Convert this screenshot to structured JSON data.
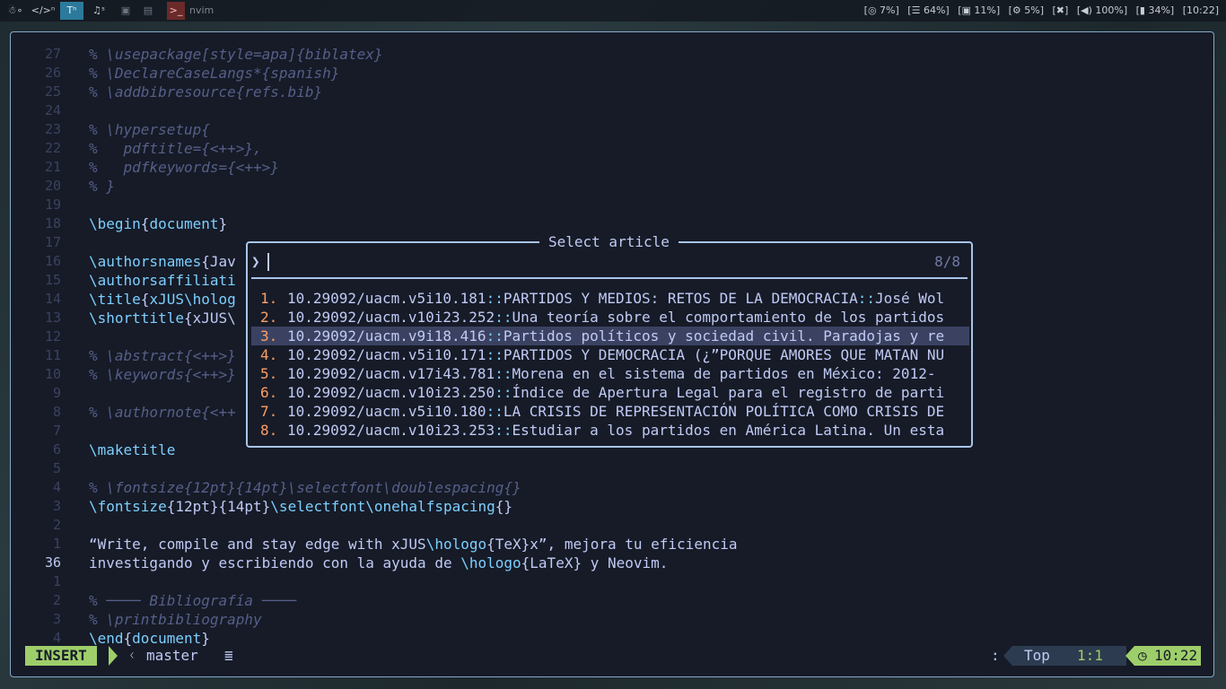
{
  "topbar": {
    "workspaces": [
      "☃∘",
      "</>ⁿ",
      "Tⁿ",
      "♫ˢ",
      "▣",
      "▤",
      ">_"
    ],
    "active_app": "nvim",
    "status": {
      "cpu": "[◎ 7%]",
      "ram": "[☰ 64%]",
      "disk": "[▣ 11%]",
      "temp": "[⚙ 5%]",
      "mic": "[✖]",
      "volume": "[◀) 100%]",
      "battery": "[▮ 34%]",
      "clock": "[10:22]"
    }
  },
  "editor": {
    "lines": [
      {
        "num": "27",
        "segments": [
          [
            "comment",
            "% \\usepackage[style=apa]{biblatex}"
          ]
        ]
      },
      {
        "num": "26",
        "segments": [
          [
            "comment",
            "% \\DeclareCaseLangs*{spanish}"
          ]
        ]
      },
      {
        "num": "25",
        "segments": [
          [
            "comment",
            "% \\addbibresource{refs.bib}"
          ]
        ]
      },
      {
        "num": "24",
        "segments": []
      },
      {
        "num": "23",
        "segments": [
          [
            "comment",
            "% \\hypersetup{"
          ]
        ]
      },
      {
        "num": "22",
        "segments": [
          [
            "comment",
            "%   pdftitle={<++>},"
          ]
        ]
      },
      {
        "num": "21",
        "segments": [
          [
            "comment",
            "%   pdfkeywords={<++>}"
          ]
        ]
      },
      {
        "num": "20",
        "segments": [
          [
            "comment",
            "% }"
          ]
        ]
      },
      {
        "num": "19",
        "segments": []
      },
      {
        "num": "18",
        "segments": [
          [
            "cmd",
            "\\begin"
          ],
          [
            "txt",
            "{"
          ],
          [
            "arg",
            "document"
          ],
          [
            "txt",
            "}"
          ]
        ]
      },
      {
        "num": "17",
        "segments": []
      },
      {
        "num": "16",
        "segments": [
          [
            "cmd",
            "\\authorsnames"
          ],
          [
            "txt",
            "{Jav"
          ]
        ]
      },
      {
        "num": "15",
        "segments": [
          [
            "cmd",
            "\\authorsaffiliati"
          ]
        ]
      },
      {
        "num": "14",
        "segments": [
          [
            "cmd",
            "\\title"
          ],
          [
            "txt",
            "{"
          ],
          [
            "arg",
            "xJUS"
          ],
          [
            "cmd",
            "\\holog"
          ]
        ]
      },
      {
        "num": "13",
        "segments": [
          [
            "cmd",
            "\\shorttitle"
          ],
          [
            "txt",
            "{xJUS\\"
          ]
        ]
      },
      {
        "num": "12",
        "segments": []
      },
      {
        "num": "11",
        "segments": [
          [
            "comment",
            "% \\abstract{<++>}"
          ]
        ]
      },
      {
        "num": "10",
        "segments": [
          [
            "comment",
            "% \\keywords{<++>}"
          ]
        ]
      },
      {
        "num": "9",
        "segments": []
      },
      {
        "num": "8",
        "segments": [
          [
            "comment",
            "% \\authornote{<++"
          ]
        ]
      },
      {
        "num": "7",
        "segments": []
      },
      {
        "num": "6",
        "segments": [
          [
            "cmd",
            "\\maketitle"
          ]
        ]
      },
      {
        "num": "5",
        "segments": []
      },
      {
        "num": "4",
        "segments": [
          [
            "comment",
            "% \\fontsize{12pt}{14pt}\\selectfont\\doublespacing{}"
          ]
        ]
      },
      {
        "num": "3",
        "segments": [
          [
            "cmd",
            "\\fontsize"
          ],
          [
            "txt",
            "{12pt}{14pt}"
          ],
          [
            "cmd",
            "\\selectfont\\onehalfspacing"
          ],
          [
            "txt",
            "{}"
          ]
        ]
      },
      {
        "num": "2",
        "segments": []
      },
      {
        "num": "1",
        "segments": [
          [
            "txt",
            "“Write, compile and stay edge with xJUS"
          ],
          [
            "cmd",
            "\\hologo"
          ],
          [
            "txt",
            "{TeX}x”, mejora tu eficiencia"
          ]
        ]
      },
      {
        "num": "36",
        "current": true,
        "segments": [
          [
            "txt",
            "investigando y escribiendo con la ayuda de "
          ],
          [
            "cmd",
            "\\hologo"
          ],
          [
            "txt",
            "{LaTeX} y Neovim."
          ]
        ]
      },
      {
        "num": "1",
        "segments": []
      },
      {
        "num": "2",
        "segments": [
          [
            "comment",
            "% ──── Bibliografía ────"
          ]
        ]
      },
      {
        "num": "3",
        "segments": [
          [
            "comment",
            "% \\printbibliography"
          ]
        ]
      },
      {
        "num": "4",
        "segments": [
          [
            "cmd",
            "\\end"
          ],
          [
            "txt",
            "{"
          ],
          [
            "arg",
            "document"
          ],
          [
            "txt",
            "}"
          ]
        ]
      }
    ]
  },
  "picker": {
    "title": "Select article",
    "prompt_icon": "❯",
    "query": "",
    "count": "8/8",
    "selected_index": 2,
    "items": [
      {
        "num": "1.",
        "doi": "10.29092/uacm.v5i10.181",
        "rest": "PARTIDOS Y MEDIOS: RETOS DE LA DEMOCRACIA",
        "tail": "José Wol"
      },
      {
        "num": "2.",
        "doi": "10.29092/uacm.v10i23.252",
        "rest": "Una teoría sobre el comportamiento de los partidos",
        "tail": ""
      },
      {
        "num": "3.",
        "doi": "10.29092/uacm.v9i18.416",
        "rest": "Partidos políticos y sociedad civil. Paradojas y re",
        "tail": ""
      },
      {
        "num": "4.",
        "doi": "10.29092/uacm.v5i10.171",
        "rest": "PARTIDOS Y DEMOCRACIA (¿”PORQUE AMORES QUE MATAN NU",
        "tail": ""
      },
      {
        "num": "5.",
        "doi": "10.29092/uacm.v17i43.781",
        "rest": "Morena en el sistema de partidos en México: 2012-",
        "tail": ""
      },
      {
        "num": "6.",
        "doi": "10.29092/uacm.v10i23.250",
        "rest": "Índice de Apertura Legal para el registro de parti",
        "tail": ""
      },
      {
        "num": "7.",
        "doi": "10.29092/uacm.v5i10.180",
        "rest": "LA CRISIS DE REPRESENTACIÓN POLÍTICA COMO CRISIS DE",
        "tail": ""
      },
      {
        "num": "8.",
        "doi": "10.29092/uacm.v10i23.253",
        "rest": "Estudiar a los partidos en América Latina. Un esta",
        "tail": ""
      }
    ]
  },
  "statusline": {
    "mode": "INSERT",
    "branch_icon": "ᚲ",
    "branch": "master",
    "lines_icon": "≣",
    "colon": ":",
    "top": "Top",
    "position": "1:1",
    "clock_icon": "◷",
    "time": "10:22"
  },
  "colors": {
    "accent": "#9ece6a",
    "popup_border": "#a9c4e8",
    "number": "#ff9e64",
    "command": "#7dcfff",
    "comment": "#565f89",
    "background": "#161b27"
  }
}
